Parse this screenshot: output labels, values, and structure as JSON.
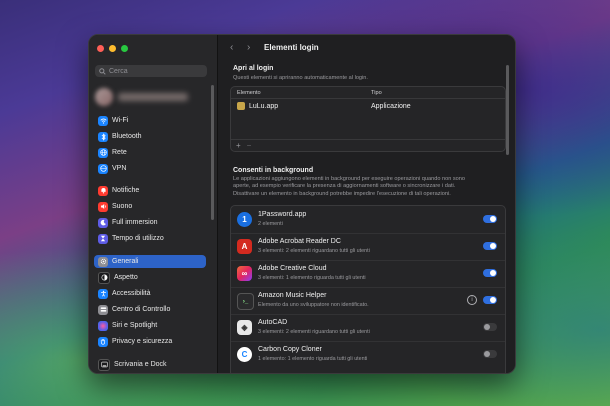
{
  "sidebar": {
    "search_placeholder": "Cerca",
    "items": [
      {
        "label": "Wi-Fi",
        "icon": "wifi-icon",
        "color": "#1a84ff"
      },
      {
        "label": "Bluetooth",
        "icon": "bluetooth-icon",
        "color": "#1a84ff"
      },
      {
        "label": "Rete",
        "icon": "globe-icon",
        "color": "#1a84ff"
      },
      {
        "label": "VPN",
        "icon": "vpn-icon",
        "color": "#1a84ff"
      },
      {
        "label": "Notifiche",
        "icon": "bell-icon",
        "color": "#ff3b30"
      },
      {
        "label": "Suono",
        "icon": "speaker-icon",
        "color": "#ff3b30"
      },
      {
        "label": "Full immersion",
        "icon": "moon-icon",
        "color": "#5e5ce6"
      },
      {
        "label": "Tempo di utilizzo",
        "icon": "hourglass-icon",
        "color": "#5e5ce6"
      },
      {
        "label": "Generali",
        "icon": "gear-icon",
        "color": "#8e8e93"
      },
      {
        "label": "Aspetto",
        "icon": "appearance-icon",
        "color": "#1c1c1e"
      },
      {
        "label": "Accessibilità",
        "icon": "accessibility-icon",
        "color": "#1a84ff"
      },
      {
        "label": "Centro di Controllo",
        "icon": "control-center-icon",
        "color": "#8e8e93"
      },
      {
        "label": "Siri e Spotlight",
        "icon": "siri-icon",
        "color": "#c03cd6"
      },
      {
        "label": "Privacy e sicurezza",
        "icon": "hand-icon",
        "color": "#1a84ff"
      },
      {
        "label": "Scrivania e Dock",
        "icon": "dock-icon",
        "color": "#1c1c1e"
      }
    ]
  },
  "header": {
    "title": "Elementi login",
    "back_glyph": "‹",
    "forward_glyph": "›"
  },
  "login_section": {
    "title": "Apri al login",
    "subtitle": "Questi elementi si apriranno automaticamente al login.",
    "columns": [
      "Elemento",
      "Tipo"
    ],
    "rows": [
      {
        "name": "LuLu.app",
        "type": "Applicazione"
      }
    ],
    "add_label": "+",
    "remove_label": "−"
  },
  "background_section": {
    "title": "Consenti in background",
    "description": [
      "Le applicazioni aggiungono elementi in background per eseguire operazioni quando non sono",
      "aperte, ad esempio verificare la presenza di aggiornamenti software o sincronizzare i dati.",
      "Disattivare un elemento in background potrebbe impedire l'esecuzione di tali operazioni."
    ],
    "items": [
      {
        "name": "1Password.app",
        "detail": "2 elementi",
        "enabled": true,
        "icon": "onepassword-icon",
        "icon_glyph": "1",
        "icon_color": "#1a6fe0",
        "info": false
      },
      {
        "name": "Adobe Acrobat Reader DC",
        "detail": "3 elementi: 2 elementi riguardano tutti gli utenti",
        "enabled": true,
        "icon": "acrobat-icon",
        "icon_glyph": "A",
        "icon_color": "#d42a1f",
        "info": false
      },
      {
        "name": "Adobe Creative Cloud",
        "detail": "3 elementi: 1 elemento riguarda tutti gli utenti",
        "enabled": true,
        "icon": "creative-cloud-icon",
        "icon_glyph": "∞",
        "icon_color": "#e3245f",
        "info": false
      },
      {
        "name": "Amazon Music Helper",
        "detail": "Elemento da uno sviluppatore non identificato.",
        "enabled": true,
        "icon": "terminal-icon",
        "icon_glyph": "›_",
        "icon_color": "#2a2a2c",
        "info": true
      },
      {
        "name": "AutoCAD",
        "detail": "3 elementi: 2 elementi riguardano tutti gli utenti",
        "enabled": false,
        "icon": "autocad-icon",
        "icon_glyph": "◈",
        "icon_color": "#e8e8e8",
        "info": false
      },
      {
        "name": "Carbon Copy Cloner",
        "detail": "1 elemento: 1 elemento riguarda tutti gli utenti",
        "enabled": false,
        "icon": "carbon-copy-cloner-icon",
        "icon_glyph": "C",
        "icon_color": "#ffffff",
        "info": false
      }
    ]
  }
}
